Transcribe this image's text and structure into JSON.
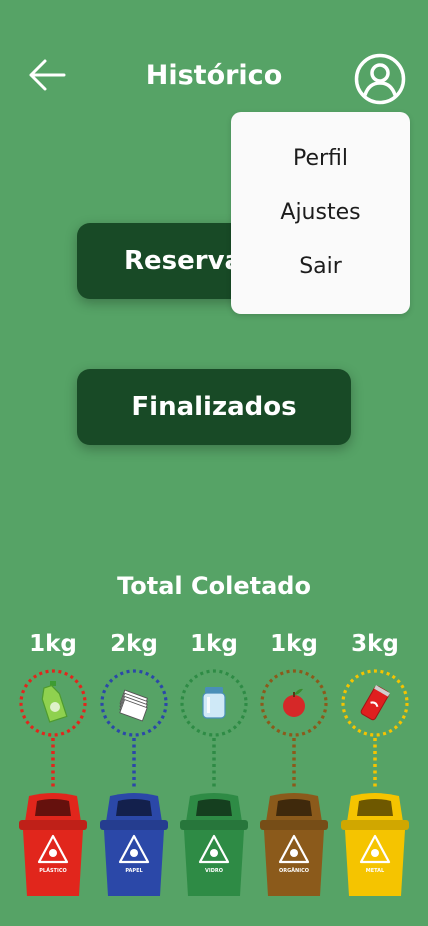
{
  "header": {
    "title": "Histórico",
    "back_icon": "arrow-left-icon",
    "profile_icon": "user-circle-icon"
  },
  "menu": {
    "items": [
      {
        "label": "Perfil"
      },
      {
        "label": "Ajustes"
      },
      {
        "label": "Sair"
      }
    ]
  },
  "buttons": {
    "reservations": "Reservados",
    "finished": "Finalizados"
  },
  "total": {
    "title": "Total Coletado",
    "bins": [
      {
        "weight": "1kg",
        "label": "PLÁSTICO",
        "color": "#e1261c",
        "icon": "bottle-icon"
      },
      {
        "weight": "2kg",
        "label": "PAPEL",
        "color": "#2b48a8",
        "icon": "paper-stack-icon"
      },
      {
        "weight": "1kg",
        "label": "VIDRO",
        "color": "#2e8b45",
        "icon": "glass-jar-icon"
      },
      {
        "weight": "1kg",
        "label": "ORGÂNICO",
        "color": "#8b5a1b",
        "icon": "apple-icon"
      },
      {
        "weight": "3kg",
        "label": "METAL",
        "color": "#f5c400",
        "icon": "soda-can-icon"
      }
    ]
  },
  "colors": {
    "background": "#56a366",
    "button": "#184a26",
    "menu": "#fafafa"
  }
}
